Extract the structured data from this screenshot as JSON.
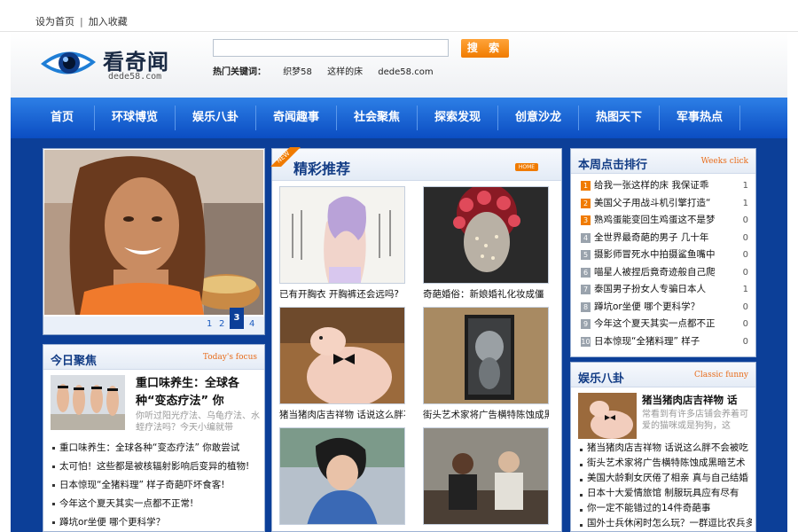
{
  "topbar": {
    "set_home": "设为首页",
    "separator": "|",
    "bookmark": "加入收藏"
  },
  "logo": {
    "name": "看奇闻",
    "domain": "dede58.com"
  },
  "search": {
    "placeholder": "",
    "button": "搜 索"
  },
  "hotwords": {
    "label": "热门关键词：",
    "words": [
      "织梦58",
      "这样的床",
      "dede58.com"
    ]
  },
  "nav": [
    "首页",
    "环球博览",
    "娱乐八卦",
    "奇闻趣事",
    "社会聚焦",
    "探索发现",
    "创意沙龙",
    "热图天下",
    "军事热点"
  ],
  "slider": {
    "pages": [
      "1",
      "2",
      "3",
      "4"
    ],
    "active": "3"
  },
  "focus": {
    "title": "今日聚焦",
    "en": "Today's focus",
    "headline": "重口味养生：全球各种“变态疗法” 你",
    "desc": "你听过阳光疗法、乌龟疗法、水蛭疗法吗？今天小编就带",
    "items": [
      "重口味养生：全球各种“变态疗法” 你敢尝试",
      "太可怕！这些都是被核辐射影响后变异的植物!",
      "日本惊现“全猪料理” 样子奇葩吓坏食客!",
      "今年这个夏天其实一点都不正常!",
      "蹲坑or坐便 哪个更科学？"
    ]
  },
  "featured": {
    "title": "精彩推荐",
    "ribbon": "NEW",
    "badge": "HOME",
    "items": [
      {
        "caption": "已有开胸衣 开胸裤还会远吗?"
      },
      {
        "caption": "奇葩婚俗：新娘婚礼化妆成僵"
      },
      {
        "caption": "猪当猪肉店吉祥物 话说这么胖不"
      },
      {
        "caption": "街头艺术家将广告横特陈蚀成黑"
      },
      {
        "caption": ""
      },
      {
        "caption": ""
      }
    ]
  },
  "ranking": {
    "title": "本周点击排行",
    "en": "Weeks click",
    "items": [
      {
        "n": "1",
        "text": "给我一张这样的床 我保证乖",
        "count": "1"
      },
      {
        "n": "2",
        "text": "美国父子用战斗机引擎打造“",
        "count": "1"
      },
      {
        "n": "3",
        "text": "熟鸡蛋能变回生鸡蛋这不是梦",
        "count": "0"
      },
      {
        "n": "4",
        "text": "全世界最奇葩的男子 几十年",
        "count": "0"
      },
      {
        "n": "5",
        "text": "摄影师冒死水中拍摄鲨鱼嘴中",
        "count": "0"
      },
      {
        "n": "6",
        "text": "喵星人被捏后竟奇迹般自己爬",
        "count": "0"
      },
      {
        "n": "7",
        "text": "泰国男子扮女人专骗日本人",
        "count": "1"
      },
      {
        "n": "8",
        "text": "蹲坑or坐便 哪个更科学？",
        "count": "0"
      },
      {
        "n": "9",
        "text": "今年这个夏天其实一点都不正",
        "count": "0"
      },
      {
        "n": "10",
        "text": "日本惊现“全猪料理” 样子",
        "count": "0"
      }
    ]
  },
  "entertainment": {
    "title": "娱乐八卦",
    "en": "Classic funny",
    "headline": "猪当猪肉店吉祥物 话",
    "desc": "常看到有许多店铺会养着可爱的猫咪或是狗狗，这",
    "items": [
      "猪当猪肉店吉祥物 话说这么胖不会被吃",
      "街头艺术家将广告横特陈蚀成黑暗艺术",
      "美国大龄剩女厌倦了相亲 真与自己结婚",
      "日本十大爱情旅馆 制服玩具应有尽有",
      "你一定不能错过的14件奇葩事",
      "国外士兵休闲时怎么玩？一群逗比农兵多"
    ]
  },
  "colors": {
    "brand_blue": "#0c3f98",
    "nav_blue": "#1762d6",
    "accent_orange": "#f07b00"
  }
}
